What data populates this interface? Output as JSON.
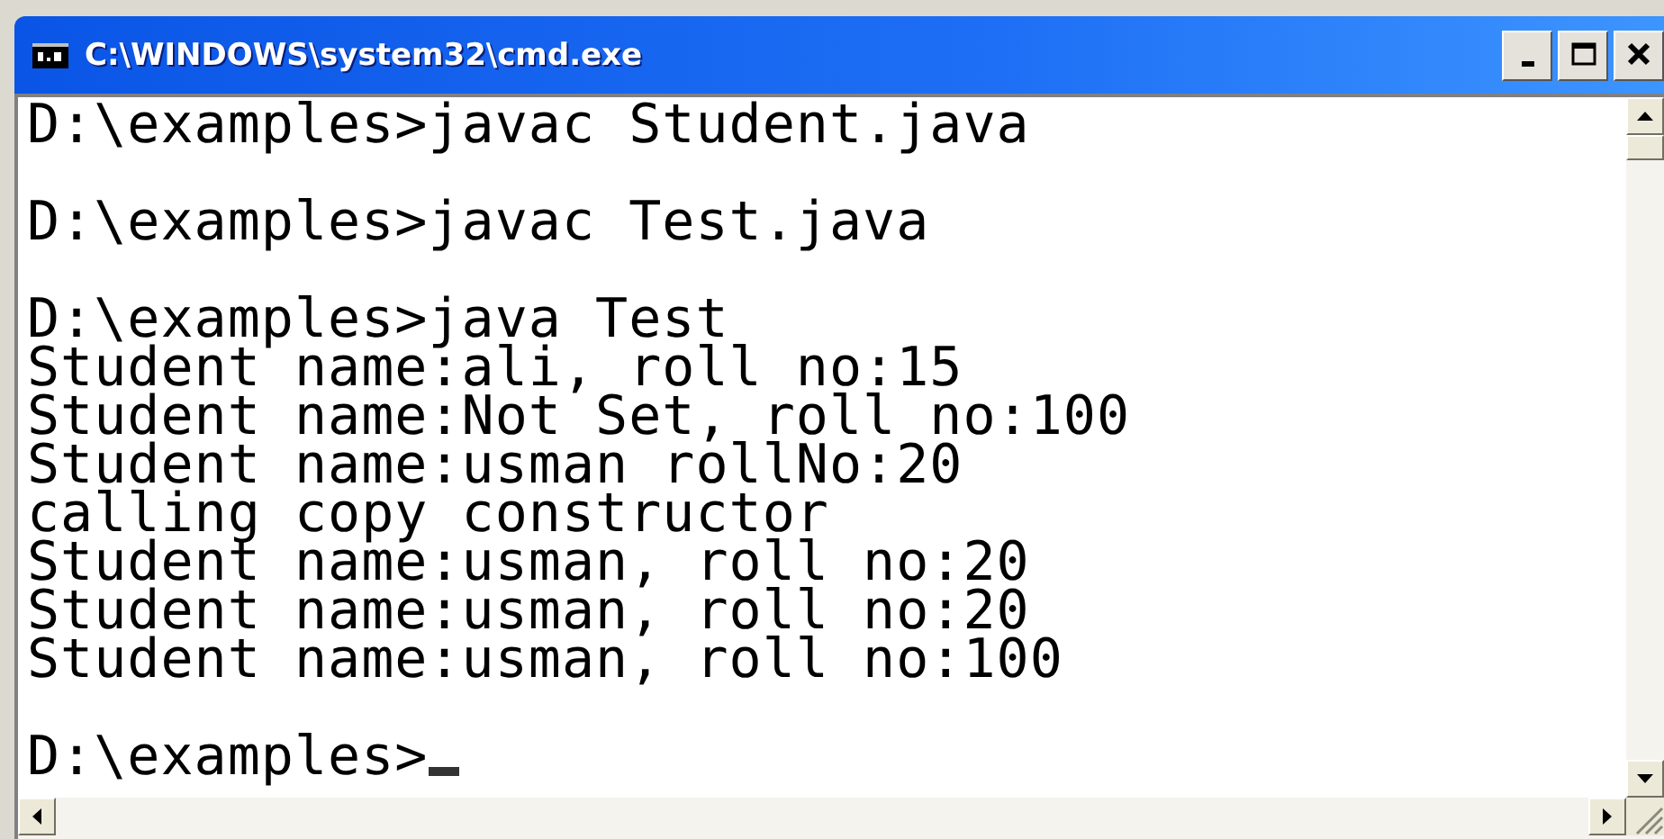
{
  "window": {
    "title": "C:\\WINDOWS\\system32\\cmd.exe"
  },
  "console": {
    "cursor_visible": true,
    "blocks": [
      [
        "D:\\examples>javac Student.java"
      ],
      [
        "D:\\examples>javac Test.java"
      ],
      [
        "D:\\examples>java Test",
        "Student name:ali, roll no:15",
        "Student name:Not Set, roll no:100",
        "Student name:usman rollNo:20",
        "calling copy constructor",
        "Student name:usman, roll no:20",
        "Student name:usman, roll no:20",
        "Student name:usman, roll no:100"
      ],
      [
        "D:\\examples>"
      ]
    ]
  }
}
